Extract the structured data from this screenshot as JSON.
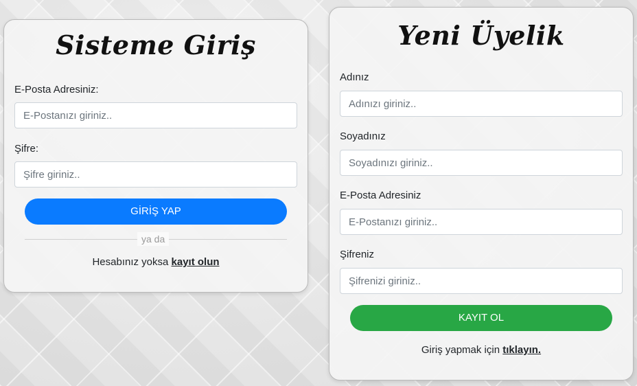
{
  "login": {
    "title": "Sisteme Giriş",
    "email_label": "E-Posta Adresiniz:",
    "email_placeholder": "E-Postanızı giriniz..",
    "password_label": "Şifre:",
    "password_placeholder": "Şifre giriniz..",
    "submit_label": "GİRİŞ YAP",
    "divider_text": "ya da",
    "footer_text": "Hesabınız yoksa",
    "footer_link": "kayıt olun",
    "accent_color": "#0a7bff"
  },
  "register": {
    "title": "Yeni Üyelik",
    "name_label": "Adınız",
    "name_placeholder": "Adınızı giriniz..",
    "surname_label": "Soyadınız",
    "surname_placeholder": "Soyadınızı giriniz..",
    "email_label": "E-Posta Adresiniz",
    "email_placeholder": "E-Postanızı giriniz..",
    "password_label": "Şifreniz",
    "password_placeholder": "Şifrenizi giriniz..",
    "submit_label": "KAYIT OL",
    "footer_text": "Giriş yapmak için",
    "footer_link": "tıklayın.",
    "accent_color": "#28a745"
  }
}
